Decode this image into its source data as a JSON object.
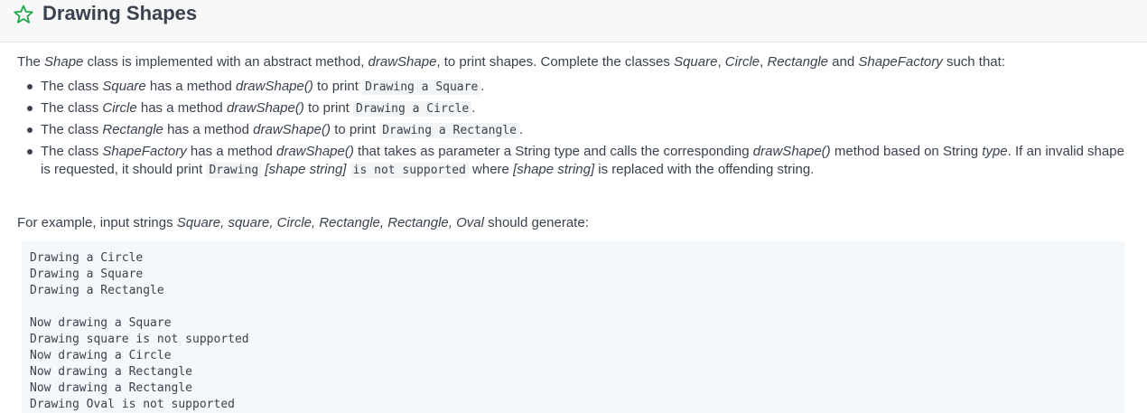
{
  "header": {
    "title": "Drawing Shapes",
    "star_icon": "star-outline-icon",
    "star_color": "#1ba94c"
  },
  "intro": {
    "t1": "The ",
    "shape": "Shape",
    "t2": " class is implemented with an abstract method, ",
    "draw": "drawShape",
    "t3": ", to print shapes. Complete the classes ",
    "square": "Square",
    "comma1": ", ",
    "circle": "Circle",
    "comma2": ", ",
    "rectangle": "Rectangle",
    "and": " and ",
    "factory": "ShapeFactory",
    "t4": " such that:"
  },
  "items": [
    {
      "a": "The class ",
      "cls": "Square",
      "b": " has a method ",
      "m": "drawShape()",
      "c": " to print ",
      "code": "Drawing a Square",
      "d": "."
    },
    {
      "a": "The class ",
      "cls": "Circle",
      "b": " has a method ",
      "m": "drawShape()",
      "c": " to print ",
      "code": "Drawing a Circle",
      "d": "."
    },
    {
      "a": "The class ",
      "cls": "Rectangle",
      "b": " has a method ",
      "m": "drawShape()",
      "c": " to print ",
      "code": "Drawing a Rectangle",
      "d": "."
    }
  ],
  "factory_item": {
    "a": "The class ",
    "cls": "ShapeFactory",
    "b": " has a method ",
    "m": "drawShape()",
    "c": " that takes as parameter a String type and calls the corresponding ",
    "m2": "drawShape()",
    "d": " method based on String ",
    "type": "type",
    "e": ". If an invalid shape is requested, it should print ",
    "code1": "Drawing",
    "sp1": " ",
    "shape_string": "[shape string]",
    "sp2": " ",
    "code2": "is not supported",
    "f": " where ",
    "shape_string2": "[shape string]",
    "g": " is replaced with the offending string."
  },
  "example": {
    "t1": "For example, input strings ",
    "inputs": "Square, square, Circle, Rectangle, Rectangle, Oval",
    "t2": " should generate:"
  },
  "output_lines": [
    "Drawing a Circle",
    "Drawing a Square",
    "Drawing a Rectangle",
    "",
    "Now drawing a Square",
    "Drawing square is not supported",
    "Now drawing a Circle",
    "Now drawing a Rectangle",
    "Now drawing a Rectangle",
    "Drawing Oval is not supported"
  ]
}
